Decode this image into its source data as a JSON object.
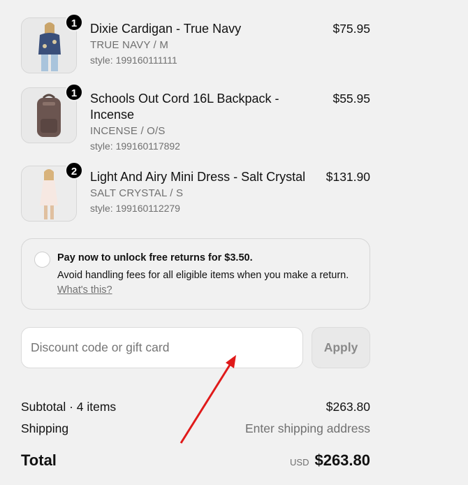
{
  "items": [
    {
      "quantity": "1",
      "name": "Dixie Cardigan - True Navy",
      "variant": "TRUE NAVY / M",
      "style": "style: 199160111111",
      "price": "$75.95",
      "image_icon": "cardigan-photo"
    },
    {
      "quantity": "1",
      "name": "Schools Out Cord 16L Backpack - Incense",
      "variant": "INCENSE / O/S",
      "style": "style: 199160117892",
      "price": "$55.95",
      "image_icon": "backpack-photo"
    },
    {
      "quantity": "2",
      "name": "Light And Airy Mini Dress - Salt Crystal",
      "variant": "SALT CRYSTAL / S",
      "style": "style: 199160112279",
      "price": "$131.90",
      "image_icon": "dress-photo"
    }
  ],
  "returns": {
    "title": "Pay now to unlock free returns for $3.50.",
    "description": "Avoid handling fees for all eligible items when you make a return.",
    "link": "What's this?"
  },
  "discount": {
    "placeholder": "Discount code or gift card",
    "apply_label": "Apply"
  },
  "summary": {
    "subtotal_label": "Subtotal · 4 items",
    "subtotal_value": "$263.80",
    "shipping_label": "Shipping",
    "shipping_value": "Enter shipping address",
    "total_label": "Total",
    "currency": "USD",
    "total_value": "$263.80"
  },
  "colors": {
    "background": "#f1f1f1",
    "annotation_arrow": "#e01a1a"
  }
}
